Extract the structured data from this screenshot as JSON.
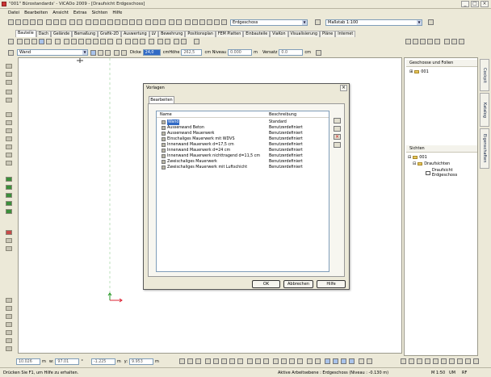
{
  "window": {
    "title": "\"001\" Bürostandards' - ViCADo 2009 - [Draufsicht Erdgeschoss]"
  },
  "menu": [
    "Datei",
    "Bearbeiten",
    "Ansicht",
    "Extras",
    "Sichten",
    "Hilfe"
  ],
  "toolbar": {
    "geschoss": "Erdgeschoss",
    "massstab": "Maßstab 1:100"
  },
  "tabs": [
    "Bauteile",
    "Dach",
    "Gelände",
    "Bemaßung",
    "Grafik-2D",
    "Auswertung",
    "LV",
    "Bewehrung",
    "Positionsplan",
    "FEM Platten",
    "Einbauteile",
    "ViaKon",
    "Visualisierung",
    "Pläne",
    "Internet"
  ],
  "props": {
    "type": "Wand",
    "dicke_label": "Dicke",
    "dicke_value": "24,0",
    "cmhoehe_label": "cmHöhe",
    "cmhoehe_value": "262,5",
    "niveau_label": "cm  Niveau",
    "niveau_value": "0.000",
    "m_label": "m",
    "versatz_label": "Versatz",
    "versatz_value": "0.0",
    "cm_label": "cm"
  },
  "right_panel": {
    "geschosse_title": "Geschosse und Folien",
    "geschosse_item": "001",
    "sichten_title": "Sichten",
    "sichten_root": "001",
    "sichten_folder": "Draufsichten",
    "sichten_item": "Draufsicht Erdgeschoss"
  },
  "side_tabs": [
    "Cockpit",
    "Katalog",
    "Eigenschaften"
  ],
  "dialog": {
    "title": "Vorlagen",
    "tab": "Bearbeiten",
    "col_name": "Name",
    "col_desc": "Beschreibung",
    "rows": [
      {
        "name": "Wand",
        "desc": "Standard"
      },
      {
        "name": "Aussenwand Beton",
        "desc": "Benutzerdefiniert"
      },
      {
        "name": "Aussenwand Mauerwerk",
        "desc": "Benutzerdefiniert"
      },
      {
        "name": "Einschaliges Mauerwerk mit WDVS",
        "desc": "Benutzerdefiniert"
      },
      {
        "name": "Innenwand Mauerwerk d=17,5 cm",
        "desc": "Benutzerdefiniert"
      },
      {
        "name": "Innenwand Mauerwerk d=24 cm",
        "desc": "Benutzerdefiniert"
      },
      {
        "name": "Innenwand Mauerwerk nichttragend d=11,5 cm",
        "desc": "Benutzerdefiniert"
      },
      {
        "name": "Zweischaliges Mauerwerk",
        "desc": "Benutzerdefiniert"
      },
      {
        "name": "Zweischaliges Mauerwerk mit Luftschicht",
        "desc": "Benutzerdefiniert"
      }
    ],
    "ok": "OK",
    "cancel": "Abbrechen",
    "help": "Hilfe"
  },
  "coords": {
    "x": "10.026",
    "x_unit": "m",
    "w": "97.01",
    "w_unit": "°",
    "dx": "-1.225",
    "dx_unit": "m",
    "y": "9.953",
    "y_label": "y:",
    "y_unit": "m"
  },
  "status": {
    "hint": "Drücken Sie F1, um Hilfe zu erhalten.",
    "ebene": "Aktive Arbeitsebene : Erdgeschoss (Niveau : -0.130 m)",
    "scale": "M 1:50",
    "um": "UM",
    "rf": "RF"
  }
}
